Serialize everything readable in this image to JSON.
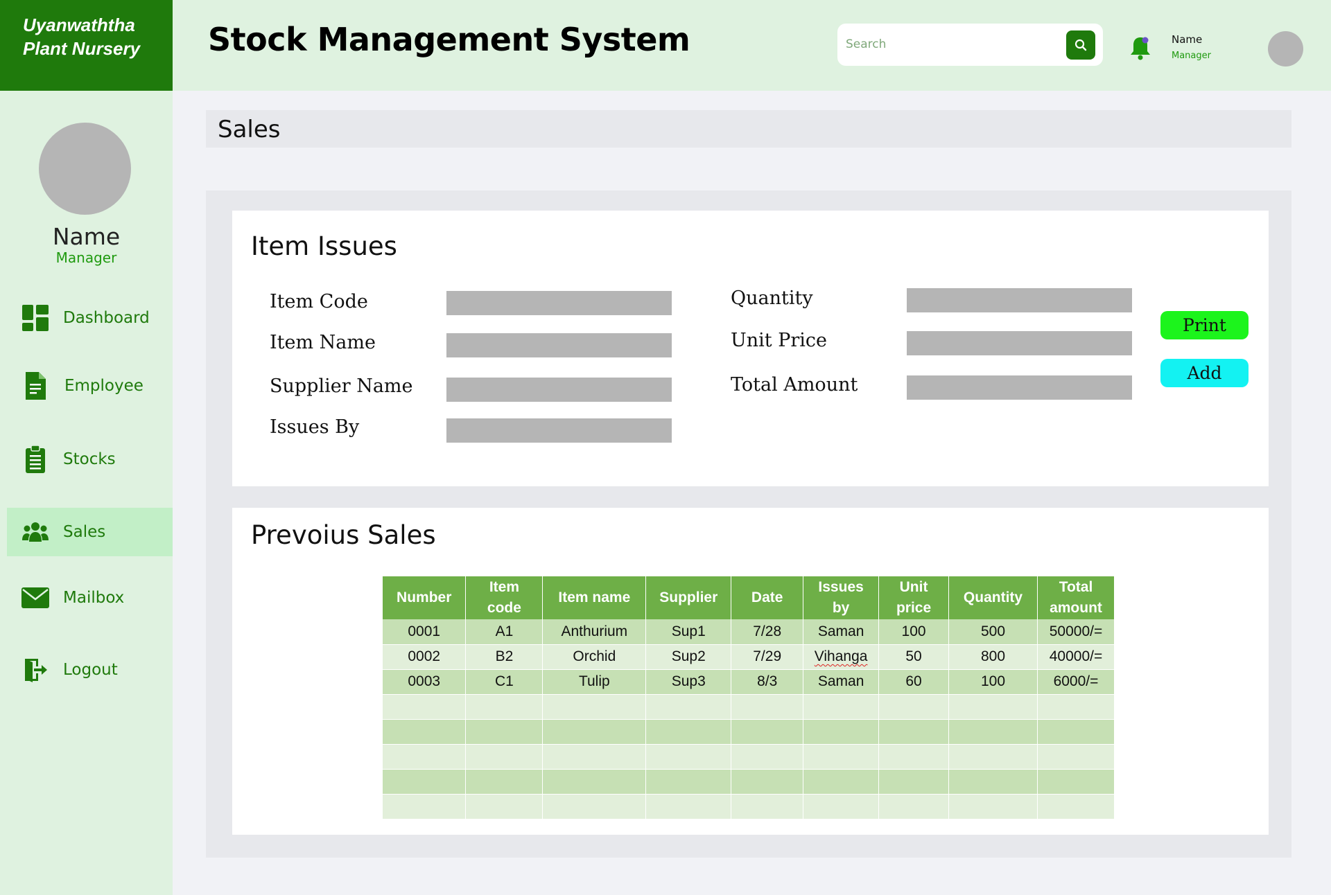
{
  "brand": {
    "line1": "Uyanwaththa",
    "line2": "Plant Nursery"
  },
  "header": {
    "title": "Stock Management System",
    "search_placeholder": "Search",
    "user_name": "Name",
    "user_role": "Manager"
  },
  "sidebar": {
    "profile_name": "Name",
    "profile_role": "Manager",
    "items": [
      {
        "label": "Dashboard",
        "icon": "dashboard-icon"
      },
      {
        "label": "Employee",
        "icon": "document-icon"
      },
      {
        "label": "Stocks",
        "icon": "clipboard-icon"
      },
      {
        "label": "Sales",
        "icon": "users-icon",
        "active": true
      },
      {
        "label": "Mailbox",
        "icon": "mail-icon"
      },
      {
        "label": "Logout",
        "icon": "logout-icon"
      }
    ]
  },
  "page": {
    "section_title": "Sales"
  },
  "item_issues": {
    "title": "Item Issues",
    "labels": {
      "item_code": "Item Code",
      "item_name": "Item Name",
      "supplier_name": "Supplier Name",
      "issues_by": "Issues By",
      "quantity": "Quantity",
      "unit_price": "Unit Price",
      "total_amount": "Total Amount"
    },
    "values": {
      "item_code": "",
      "item_name": "",
      "supplier_name": "",
      "issues_by": "",
      "quantity": "",
      "unit_price": "",
      "total_amount": ""
    },
    "print_label": "Print",
    "add_label": "Add"
  },
  "previous_sales": {
    "title": "Prevoius Sales",
    "headers": [
      [
        "Number"
      ],
      [
        "Item",
        "code"
      ],
      [
        "Item name"
      ],
      [
        "Supplier"
      ],
      [
        "Date"
      ],
      [
        "Issues",
        "by"
      ],
      [
        "Unit",
        "price"
      ],
      [
        "Quantity"
      ],
      [
        "Total",
        "amount"
      ]
    ],
    "rows": [
      [
        "0001",
        "A1",
        "Anthurium",
        "Sup1",
        "7/28",
        "Saman",
        "100",
        "500",
        "50000/="
      ],
      [
        "0002",
        "B2",
        "Orchid",
        "Sup2",
        "7/29",
        "Vihanga",
        "50",
        "800",
        "40000/="
      ],
      [
        "0003",
        "C1",
        "Tulip",
        "Sup3",
        "8/3",
        "Saman",
        "60",
        "100",
        "6000/="
      ],
      [
        "",
        "",
        "",
        "",
        "",
        "",
        "",
        "",
        ""
      ],
      [
        "",
        "",
        "",
        "",
        "",
        "",
        "",
        "",
        ""
      ],
      [
        "",
        "",
        "",
        "",
        "",
        "",
        "",
        "",
        ""
      ],
      [
        "",
        "",
        "",
        "",
        "",
        "",
        "",
        "",
        ""
      ],
      [
        "",
        "",
        "",
        "",
        "",
        "",
        "",
        "",
        ""
      ]
    ]
  },
  "colors": {
    "brand_green": "#1f7a0c",
    "light_green_bg": "#dff2e0",
    "active_nav": "#c2efc7",
    "table_header": "#6eaf47",
    "print_button": "#1cf41c",
    "add_button": "#13f2f2"
  }
}
